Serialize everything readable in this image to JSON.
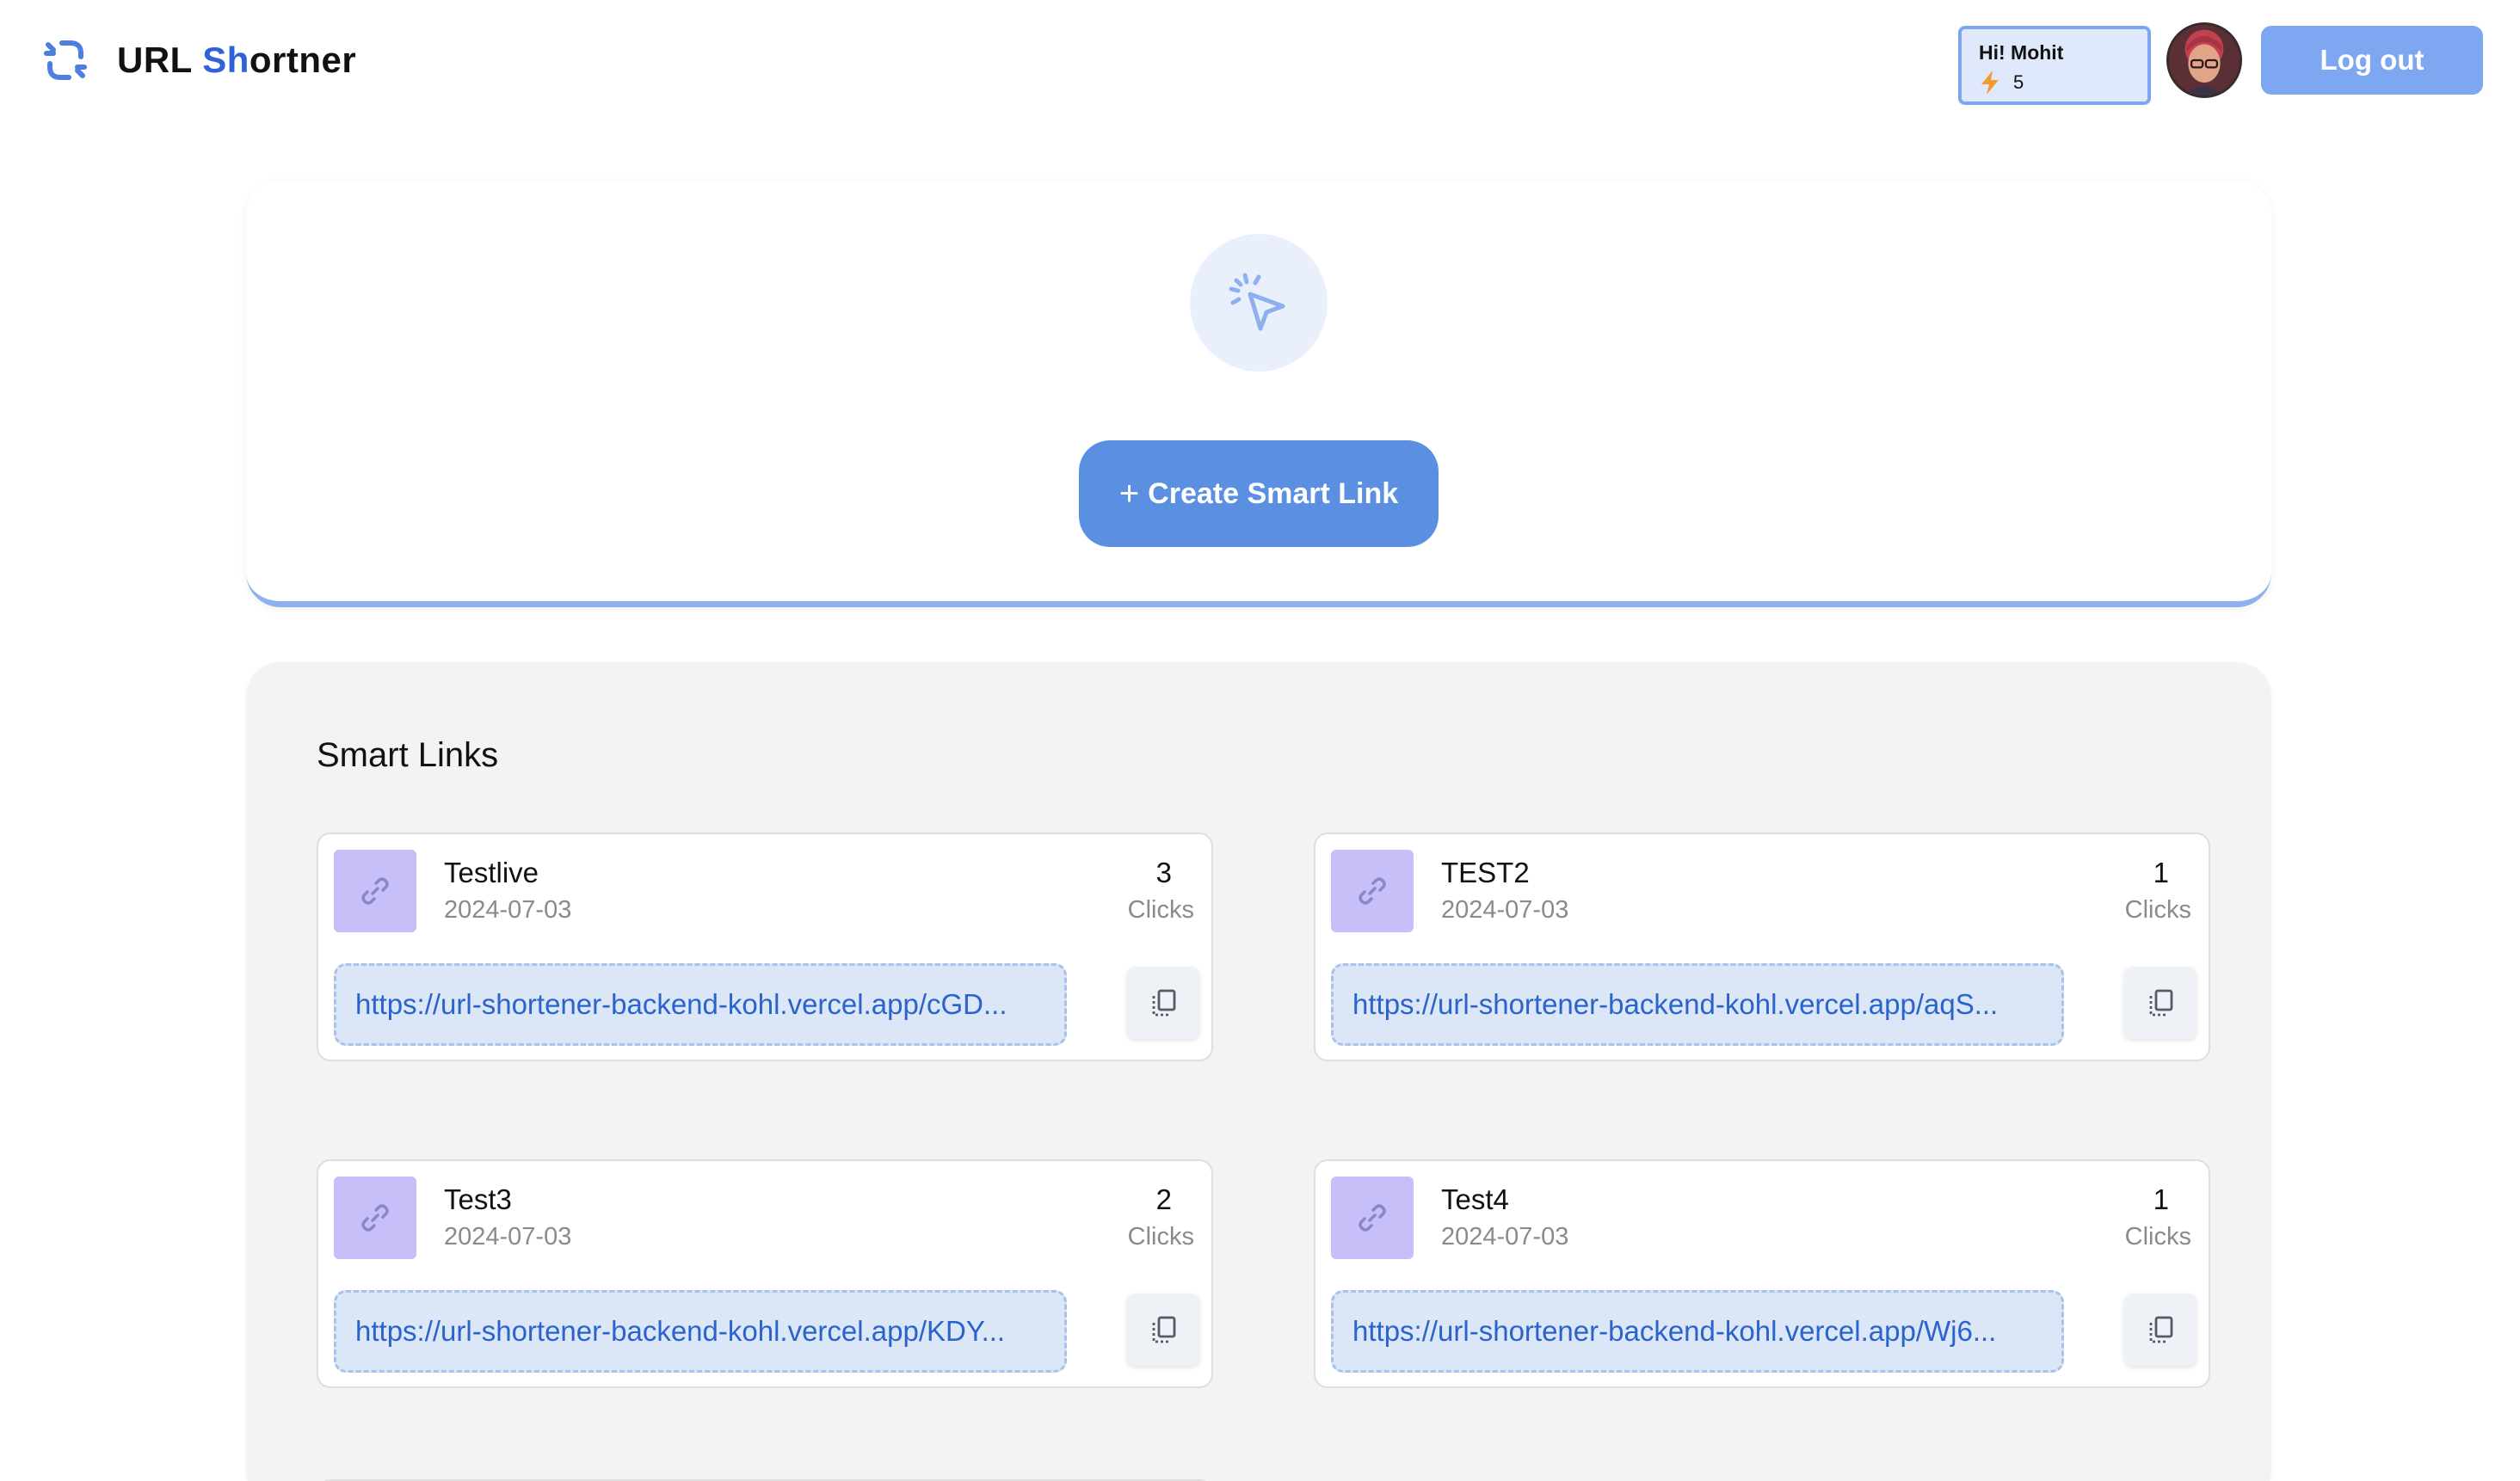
{
  "brand": {
    "title_part1": "URL ",
    "title_accent": "Sh",
    "title_part2": "ortner",
    "logo_icon": "broken-link-icon"
  },
  "user": {
    "greeting": "Hi! Mohit",
    "credits": "5",
    "credit_icon": "lightning-bolt-icon",
    "avatar_icon": "user-avatar"
  },
  "header": {
    "logout_label": "Log out"
  },
  "create": {
    "icon": "pointer-click-icon",
    "plus": "+",
    "button_label": "Create Smart Link"
  },
  "links": {
    "title": "Smart Links",
    "clicks_label": "Clicks",
    "items": [
      {
        "name": "Testlive",
        "date": "2024-07-03",
        "clicks": "3",
        "url": "https://url-shortener-backend-kohl.vercel.app/cGD..."
      },
      {
        "name": "TEST2",
        "date": "2024-07-03",
        "clicks": "1",
        "url": "https://url-shortener-backend-kohl.vercel.app/aqS..."
      },
      {
        "name": "Test3",
        "date": "2024-07-03",
        "clicks": "2",
        "url": "https://url-shortener-backend-kohl.vercel.app/KDY..."
      },
      {
        "name": "Test4",
        "date": "2024-07-03",
        "clicks": "1",
        "url": "https://url-shortener-backend-kohl.vercel.app/Wj6..."
      }
    ]
  },
  "colors": {
    "accent": "#2f62d8",
    "primary_button": "#5b8fe2",
    "logout_button": "#7da7f0",
    "link_text": "#2a63cc",
    "thumb": "#c7c0f8"
  }
}
